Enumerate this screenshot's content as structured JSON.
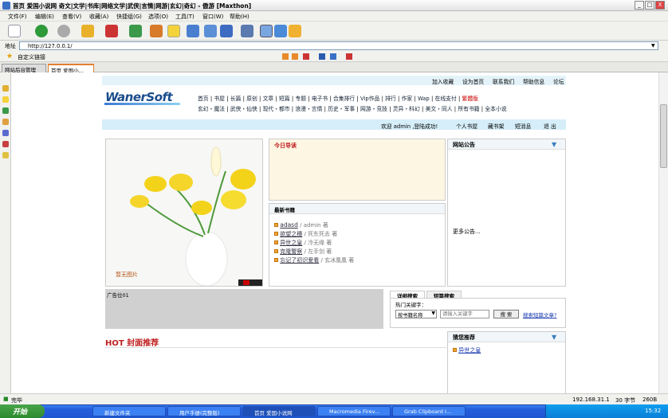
{
  "window": {
    "title": "首页 爱国小说网 奇文|文学|书库|网络文学|武侠|言情|网游|玄幻|奇幻 - 傲游 [Maxthon]",
    "min": "_",
    "max": "□",
    "close": "X"
  },
  "menu": [
    "文件(F)",
    "编辑(E)",
    "查看(V)",
    "收藏(A)",
    "快捷组(G)",
    "选项(O)",
    "工具(T)",
    "窗口(W)",
    "帮助(H)"
  ],
  "address": {
    "label": "地址",
    "value": "http://127.0.0.1/"
  },
  "links": {
    "label": "自定义链接"
  },
  "tabs": [
    "网站后台管理",
    "首页 爱国小..."
  ],
  "site": {
    "top_links": [
      "加入收藏",
      "设为首页",
      "联系我们",
      "帮助信息",
      "论坛"
    ],
    "logo": "WanerSoft",
    "nav1": [
      "首页",
      "书屋",
      "长篇",
      "原创",
      "文章",
      "短篇",
      "专题",
      "电子书",
      "合集排行",
      "Vip作品",
      "排行",
      "作家",
      "Wap",
      "在线支付",
      "繁體版"
    ],
    "nav2": [
      "玄幻・魔法",
      "武侠・仙侠",
      "现代・都市",
      "浪漫・言情",
      "历史・军事",
      "网游・竞技",
      "灵异・科幻",
      "美文・同人",
      "所有书籍",
      "全本小说"
    ],
    "welcome": "欢迎 admin ,登陆成功!",
    "user_links": [
      "个人书屋",
      "藏书架",
      "短消息",
      "退 出"
    ],
    "no_image": "暂无图片",
    "today_title": "今日导读",
    "new_books_title": "最新书籍",
    "books": [
      {
        "title": "adasd",
        "author": "admin 著"
      },
      {
        "title": "欲望之穗",
        "author": "死东死去 著"
      },
      {
        "title": "异世之皇",
        "author": "冷无缘 著"
      },
      {
        "title": "克隆警察",
        "author": "左手剑 著"
      },
      {
        "title": "忘记了初识爱看",
        "author": "玄冰凰凰 著"
      }
    ],
    "notice_title": "网站公告",
    "notice_more": "更多公告...",
    "ad_label": "广告位01",
    "search_tabs": [
      "详细搜索",
      "短篇搜索"
    ],
    "search_hot": "热门关键字：",
    "search_select": "按书籍名称",
    "search_placeholder": "请输入关键字",
    "search_btn": "搜 索",
    "search_adv": "搜索短篇文章?",
    "hot_title": "HOT 封面推荐",
    "like_title": "猜您推荐",
    "like_item": "异世之皇"
  },
  "status": {
    "left": "完毕",
    "ip": "192.168.31.1",
    "chars": "30 字节",
    "size": "260B"
  },
  "taskbar": {
    "start": "开始",
    "tasks": [
      "新建文件夹",
      "用户手册(完整版)",
      "首页 爱国小说网",
      "Macromedia Firev...",
      "Grab Clipboard I..."
    ],
    "clock": "15:32"
  }
}
